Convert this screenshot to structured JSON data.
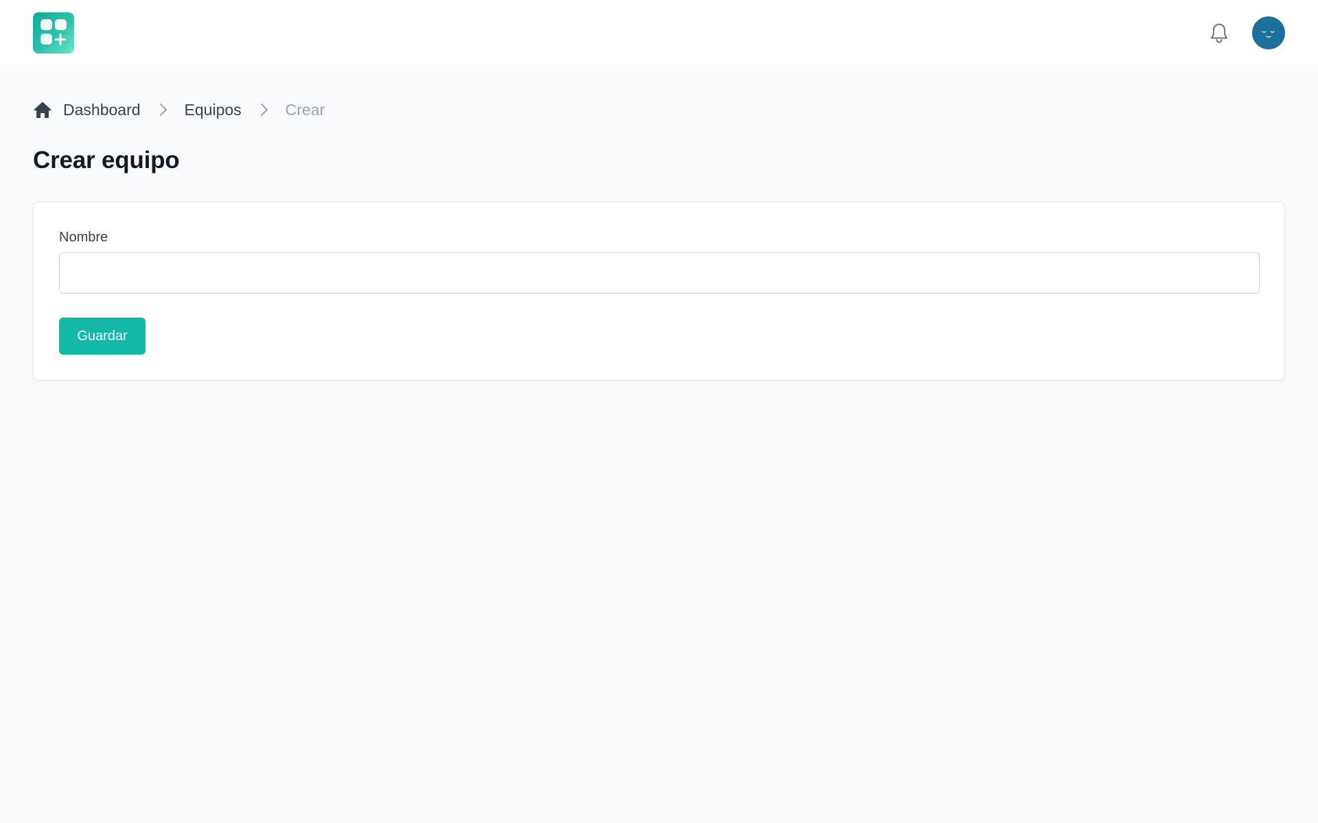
{
  "header": {
    "logo_icon": "app-grid-plus-icon",
    "notifications_icon": "bell-icon",
    "avatar_icon": "user-avatar"
  },
  "breadcrumb": {
    "home_icon": "home-icon",
    "items": [
      {
        "label": "Dashboard"
      },
      {
        "label": "Equipos"
      },
      {
        "label": "Crear"
      }
    ],
    "separator_icon": "chevron-right-icon"
  },
  "page": {
    "title": "Crear equipo"
  },
  "form": {
    "name_label": "Nombre",
    "name_value": "",
    "name_placeholder": "",
    "save_label": "Guardar"
  },
  "colors": {
    "background": "#f9fafb",
    "accent": "#14b8a6",
    "avatar": "#1b7199",
    "muted_text": "#9ca3af"
  }
}
